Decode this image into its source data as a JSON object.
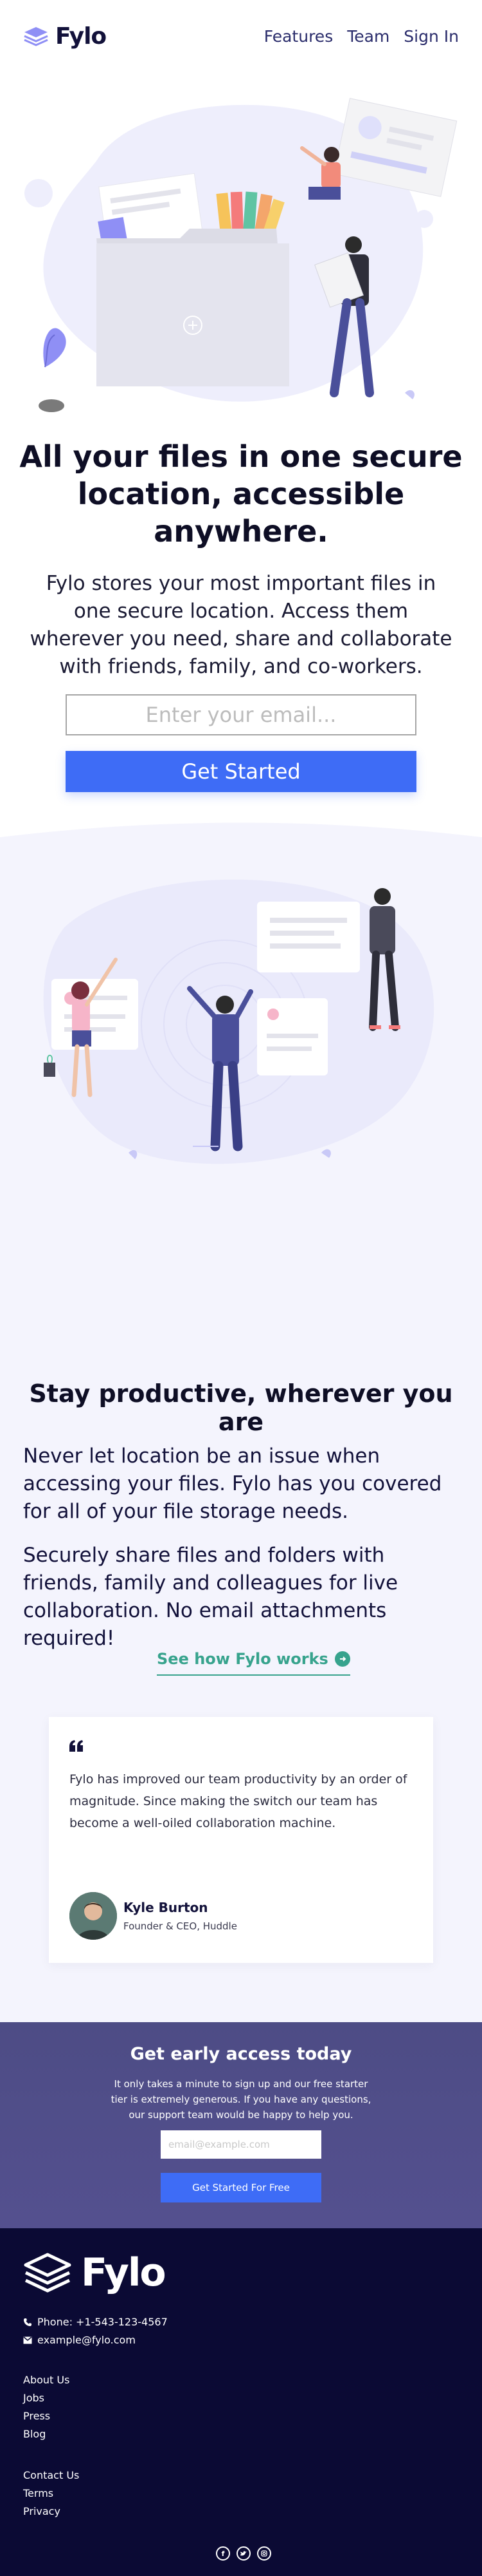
{
  "brand": {
    "name": "Fylo"
  },
  "nav": {
    "items": [
      "Features",
      "Team",
      "Sign In"
    ]
  },
  "hero": {
    "title": "All your files in one secure location, accessible anywhere.",
    "text": "Fylo stores your most important files in one secure location. Access them wherever you need, share and collaborate with friends, family, and co-workers.",
    "email_placeholder": "Enter your email...",
    "cta": "Get Started"
  },
  "productive": {
    "title": "Stay productive, wherever you are",
    "p1": "Never let location be an issue when accessing your files. Fylo has you covered for all of your file storage needs.",
    "p2": "Securely share files and folders with friends, family and colleagues for live collaboration. No email attachments required!",
    "link": "See how Fylo works"
  },
  "testimonial": {
    "text": "Fylo has improved our team productivity by an order of magnitude. Since making the switch our team has become a well-oiled collaboration machine.",
    "name": "Kyle Burton",
    "role": "Founder & CEO, Huddle"
  },
  "early_access": {
    "title": "Get early access today",
    "text": "It only takes a minute to sign up and our free starter tier is extremely generous. If you have any questions, our support team would be happy to help you.",
    "email_placeholder": "email@example.com",
    "cta": "Get Started For Free"
  },
  "footer": {
    "phone": "Phone: +1-543-123-4567",
    "email": "example@fylo.com",
    "links_a": [
      "About Us",
      "Jobs",
      "Press",
      "Blog"
    ],
    "links_b": [
      "Contact Us",
      "Terms",
      "Privacy"
    ],
    "socials": [
      "facebook-icon",
      "twitter-icon",
      "instagram-icon"
    ]
  },
  "colors": {
    "accent_blue": "#3e6cf6",
    "link_teal": "#37a38d",
    "section_tint": "#f4f4fd",
    "cta_band": "#4d4c85",
    "footer_navy": "#0b0a34"
  }
}
